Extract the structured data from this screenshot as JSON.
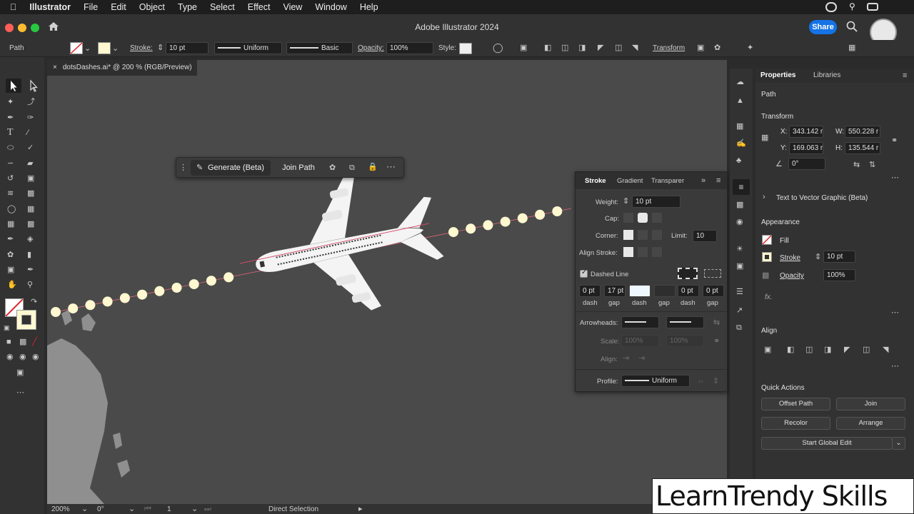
{
  "menubar": {
    "app": "Illustrator",
    "items": [
      "File",
      "Edit",
      "Object",
      "Type",
      "Select",
      "Effect",
      "View",
      "Window",
      "Help"
    ]
  },
  "titlebar": {
    "title": "Adobe Illustrator 2024",
    "share_label": "Share"
  },
  "control": {
    "selection": "Path",
    "stroke_label": "Stroke:",
    "stroke_value": "10 pt",
    "profile": "Uniform",
    "brush": "Basic",
    "opacity_label": "Opacity:",
    "opacity_value": "100%",
    "style_label": "Style:",
    "transform_label": "Transform"
  },
  "document": {
    "tab": "dotsDashes.ai* @ 200 % (RGB/Preview)"
  },
  "context_bar": {
    "generate": "Generate (Beta)",
    "join": "Join Path"
  },
  "stroke_panel": {
    "tabs": [
      "Stroke",
      "Gradient",
      "Transparer"
    ],
    "weight_label": "Weight:",
    "weight_value": "10 pt",
    "cap_label": "Cap:",
    "corner_label": "Corner:",
    "limit_label": "Limit:",
    "limit_value": "10",
    "align_label": "Align Stroke:",
    "dashed_label": "Dashed Line",
    "dashed_checked": true,
    "dash_values": [
      "0 pt",
      "17 pt",
      "",
      "",
      "0 pt",
      "0 pt"
    ],
    "dash_labels": [
      "dash",
      "gap",
      "dash",
      "gap",
      "dash",
      "gap"
    ],
    "arrowheads_label": "Arrowheads:",
    "scale_label": "Scale:",
    "scale_values": [
      "100%",
      "100%"
    ],
    "align_arrow_label": "Align:",
    "profile_label": "Profile:",
    "profile_value": "Uniform"
  },
  "properties": {
    "tabs": [
      "Properties",
      "Libraries"
    ],
    "selection": "Path",
    "transform_title": "Transform",
    "x_label": "X:",
    "x_value": "343.142 r",
    "y_label": "Y:",
    "y_value": "169.063 r",
    "w_label": "W:",
    "w_value": "550.228 r",
    "h_label": "H:",
    "h_value": "135.544 r",
    "angle_value": "0°",
    "text_to_vector": "Text to Vector Graphic (Beta)",
    "appearance_title": "Appearance",
    "fill_label": "Fill",
    "stroke_label": "Stroke",
    "stroke_value": "10 pt",
    "opacity_label": "Opacity",
    "opacity_value": "100%",
    "fx_label": "fx.",
    "align_title": "Align",
    "quick_actions_title": "Quick Actions",
    "buttons": [
      "Offset Path",
      "Join",
      "Recolor",
      "Arrange"
    ],
    "global_edit": "Start Global Edit"
  },
  "status": {
    "zoom": "200%",
    "rotation": "0°",
    "artboard": "1",
    "tool": "Direct Selection"
  },
  "watermark": "LearnTrendy Skills",
  "colors": {
    "dot_fill": "#fff8d0",
    "canvas": "#4a4a4a",
    "land": "#8f8f8f",
    "accent": "#1473e6"
  }
}
